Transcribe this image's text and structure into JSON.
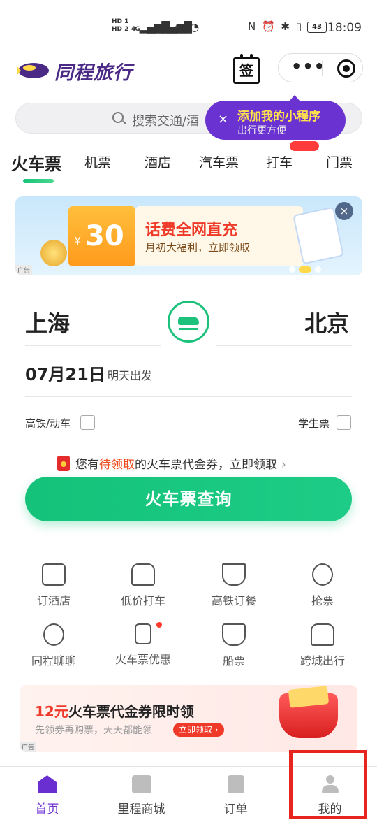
{
  "status_bar": {
    "hd1": "HD 1",
    "hd2": "HD 2",
    "signal1": "4G",
    "signal2": "4G",
    "battery": "43",
    "time": "18:09"
  },
  "header": {
    "app_name": "同程旅行",
    "sign_label": "签",
    "more_label": "•••"
  },
  "search": {
    "placeholder": "搜索交通/酒"
  },
  "tooltip": {
    "close": "×",
    "title": "添加我的小程序",
    "subtitle": "出行更方便"
  },
  "tabs": [
    {
      "label": "火车票"
    },
    {
      "label": "机票"
    },
    {
      "label": "酒店"
    },
    {
      "label": "汽车票"
    },
    {
      "label": "打车"
    },
    {
      "label": "门票"
    }
  ],
  "banner": {
    "yen": "¥",
    "amount": "30",
    "title": "话费全网直充",
    "subtitle": "月初大福利，立即领取",
    "close": "×",
    "ad": "广告"
  },
  "booking": {
    "from": "上海",
    "to": "北京",
    "date": "07月21日",
    "date_hint": "明天出发",
    "option_highspeed": "高铁/动车",
    "option_student": "学生票",
    "coupon_prefix": "您有",
    "coupon_highlight": "待领取",
    "coupon_suffix": "的火车票代金券，立即领取",
    "coupon_arrow": "›",
    "query_button": "火车票查询"
  },
  "services": [
    {
      "label": "订酒店",
      "icon": "hotel-icon"
    },
    {
      "label": "低价打车",
      "icon": "taxi-icon"
    },
    {
      "label": "高铁订餐",
      "icon": "meal-icon"
    },
    {
      "label": "抢票",
      "icon": "stopwatch-icon"
    },
    {
      "label": "同程聊聊",
      "icon": "chat-icon"
    },
    {
      "label": "火车票优惠",
      "icon": "ticket-discount-icon"
    },
    {
      "label": "船票",
      "icon": "ship-icon"
    },
    {
      "label": "跨城出行",
      "icon": "intercity-car-icon"
    }
  ],
  "promo": {
    "amount": "12元",
    "title": "火车票代金券限时领",
    "subtitle": "先领券再购票，天天都能领",
    "button": "立即领取 ›",
    "ad": "广告"
  },
  "bottom_nav": [
    {
      "label": "首页",
      "icon": "home-icon"
    },
    {
      "label": "里程商城",
      "icon": "shopping-bag-icon"
    },
    {
      "label": "订单",
      "icon": "order-list-icon"
    },
    {
      "label": "我的",
      "icon": "person-icon"
    }
  ],
  "colors": {
    "brand_purple": "#6a2fd0",
    "accent_green": "#1cc27c",
    "highlight_red": "#e8241e"
  }
}
